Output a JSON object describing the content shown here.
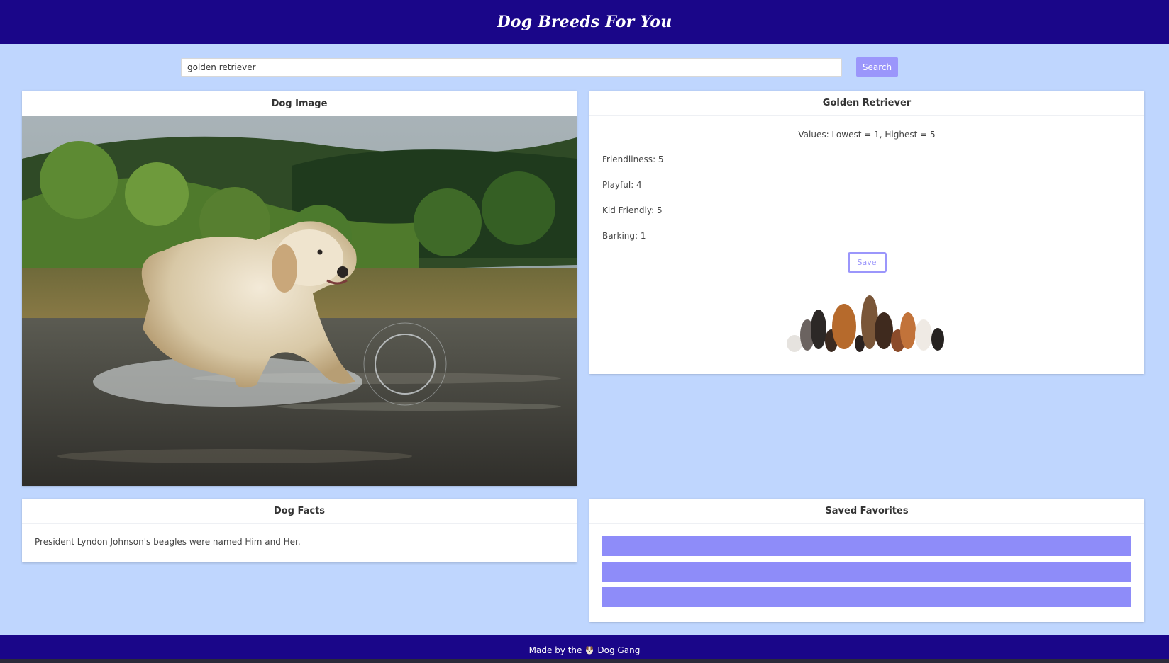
{
  "header": {
    "title": "Dog Breeds For You"
  },
  "search": {
    "value": "golden retriever",
    "button_label": "Search"
  },
  "image_card": {
    "title": "Dog Image"
  },
  "breed_card": {
    "title": "Golden Retriever",
    "values_note": "Values: Lowest = 1, Highest = 5",
    "stats": [
      {
        "label": "Friendliness: 5"
      },
      {
        "label": "Playful: 4"
      },
      {
        "label": "Kid Friendly: 5"
      },
      {
        "label": "Barking: 1"
      }
    ],
    "save_label": "Save"
  },
  "facts_card": {
    "title": "Dog Facts",
    "fact": "President Lyndon Johnson's beagles were named Him and Her."
  },
  "favorites_card": {
    "title": "Saved Favorites",
    "items": [
      "",
      "",
      ""
    ]
  },
  "footer": {
    "text_before": "Made by the",
    "text_after": "Dog Gang"
  },
  "colors": {
    "header_bg": "#1a0689",
    "page_bg": "#bfd6fe",
    "accent": "#9b96fb",
    "favorite_bar": "#8e8cf9"
  }
}
